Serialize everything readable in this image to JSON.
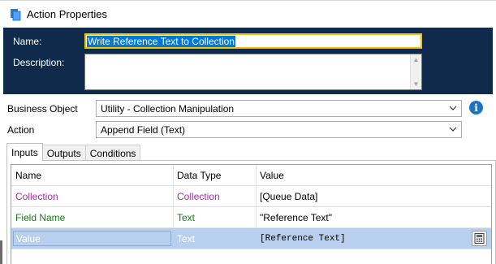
{
  "window": {
    "title": "Action Properties"
  },
  "header": {
    "name_label": "Name:",
    "name_value": "Write Reference Text to Collection",
    "description_label": "Description:",
    "description_value": ""
  },
  "form": {
    "business_object_label": "Business Object",
    "business_object_value": "Utility - Collection Manipulation",
    "action_label": "Action",
    "action_value": "Append Field (Text)"
  },
  "tabs": [
    {
      "label": "Inputs",
      "active": true
    },
    {
      "label": "Outputs",
      "active": false
    },
    {
      "label": "Conditions",
      "active": false
    }
  ],
  "grid": {
    "columns": [
      "Name",
      "Data Type",
      "Value"
    ],
    "rows": [
      {
        "name": "Collection",
        "type": "Collection",
        "value": "[Queue Data]",
        "color": "#a033a0"
      },
      {
        "name": "Field Name",
        "type": "Text",
        "value": "\"Reference Text\"",
        "color": "#1a7a1a"
      },
      {
        "name": "Value",
        "type": "Text",
        "value": "[Reference Text]",
        "color": "#ffffff",
        "selected": true
      }
    ]
  },
  "colors": {
    "header_bg": "#0f2a4a",
    "name_border": "#f2c300",
    "selection_bg": "#0078d7",
    "row_selected": "#b9cfee",
    "collection_color": "#a033a0",
    "text_color": "#1a7a1a",
    "info_icon": "#1e73be"
  },
  "icons": {
    "app": "process-action-icon",
    "info": "info-icon",
    "dropdown": "chevron-down-icon",
    "expression": "calculator-icon"
  }
}
